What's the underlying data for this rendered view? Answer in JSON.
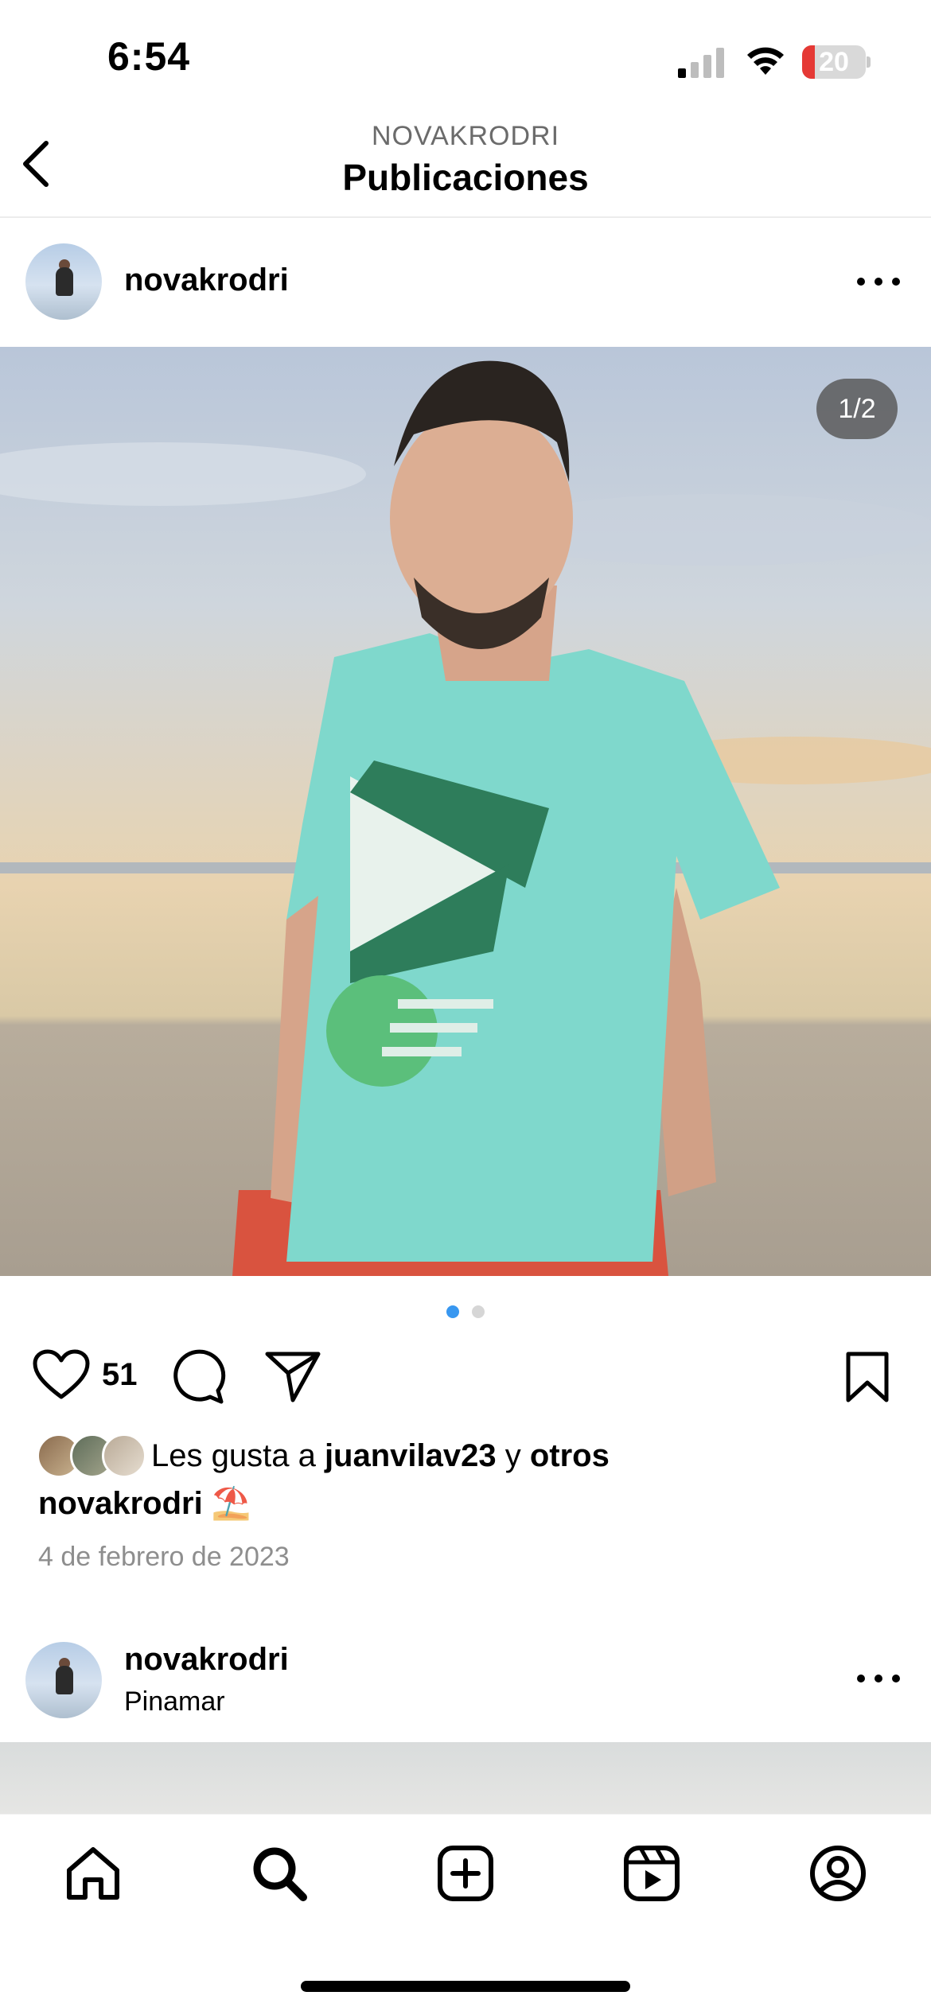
{
  "status_bar": {
    "time": "6:54",
    "battery_level": "20",
    "battery_fraction": 0.2
  },
  "header": {
    "subtitle": "NOVAKRODRI",
    "title": "Publicaciones"
  },
  "post": {
    "username": "novakrodri",
    "carousel_counter": "1/2",
    "carousel_total": 2,
    "carousel_active": 1,
    "likes_count": "51",
    "liked_by": {
      "prefix": "Les gusta a ",
      "user": "juanvilav23",
      "connector": " y ",
      "others": "otros"
    },
    "caption_user": "novakrodri",
    "caption_emoji": "⛱️",
    "date": "4 de febrero de 2023",
    "photo_description_icon": "photo-venice-beach"
  },
  "next_post": {
    "username": "novakrodri",
    "location": "Pinamar"
  },
  "tabbar": {
    "items": [
      "home",
      "search",
      "create",
      "reels",
      "profile"
    ],
    "active": "search"
  },
  "colors": {
    "accent_dot": "#3897f0",
    "battery_low": "#e53935"
  }
}
